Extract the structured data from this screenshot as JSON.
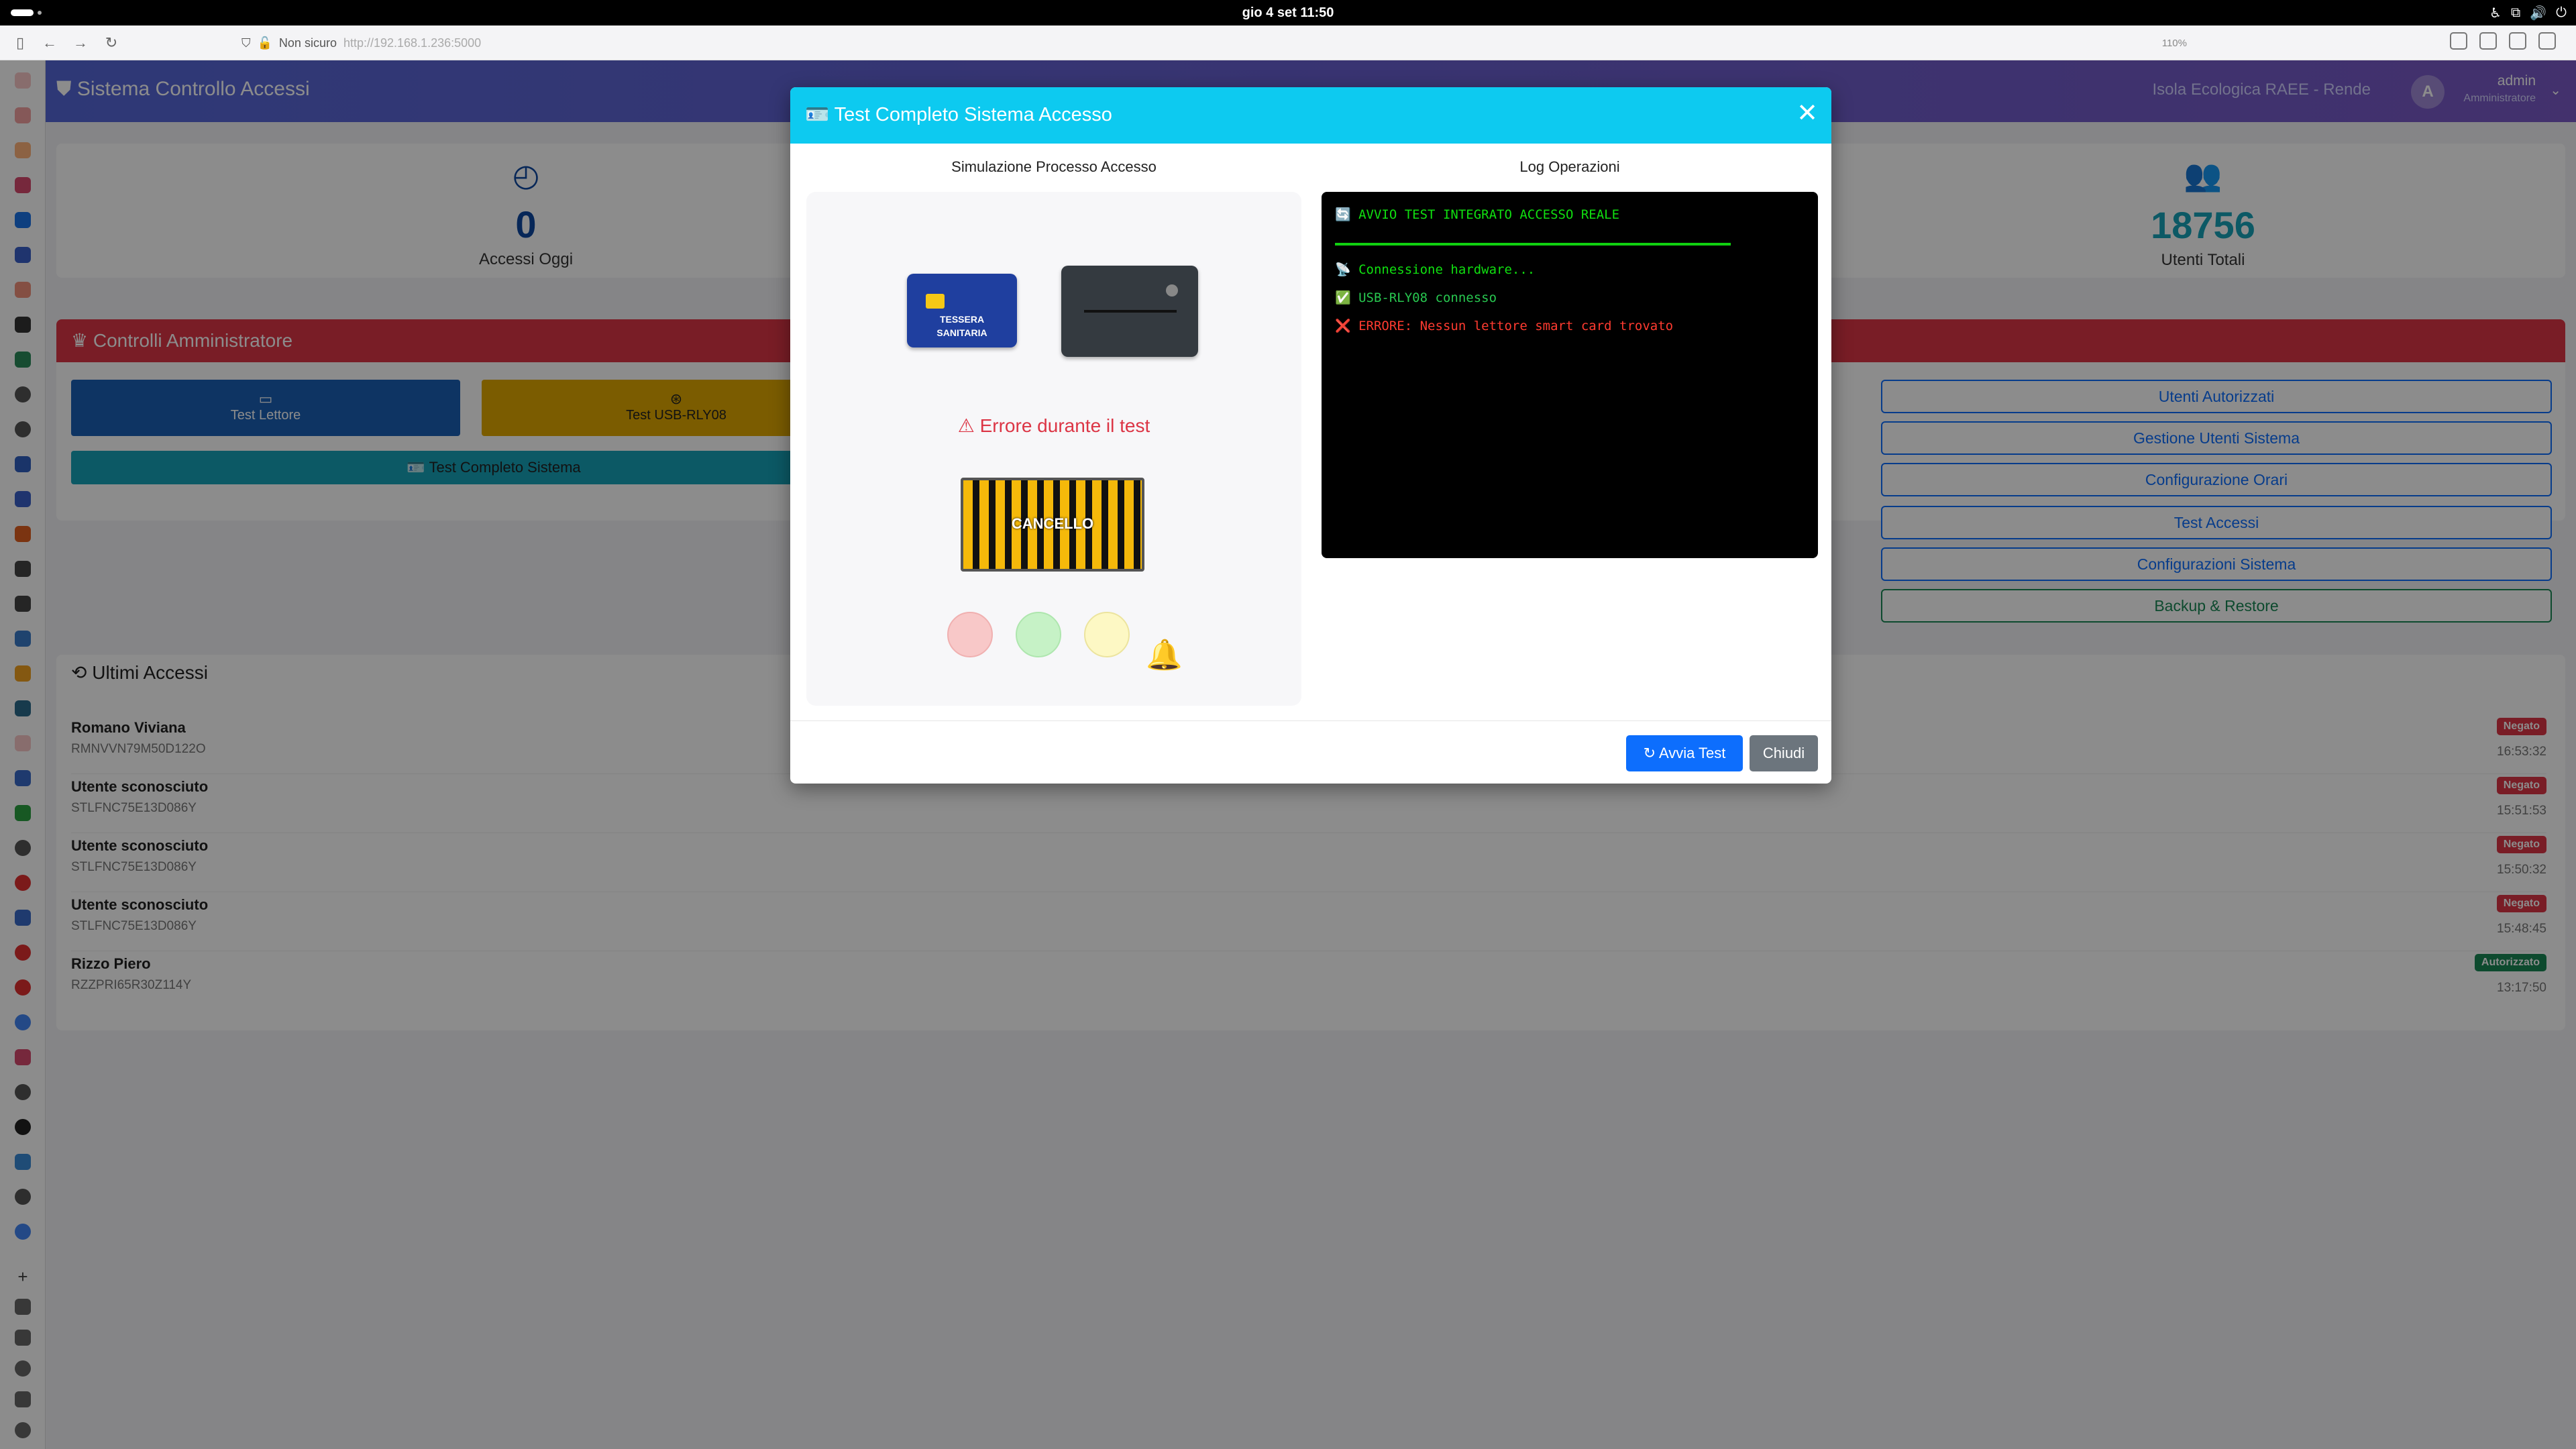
{
  "system": {
    "clock": "gio 4 set  11:50"
  },
  "browser": {
    "security_label": "Non sicuro",
    "url": "http://192.168.1.236:5000",
    "zoom": "110%"
  },
  "app": {
    "brand": "Sistema Controllo Accessi",
    "site": "Isola Ecologica RAEE - Rende",
    "user": {
      "initial": "A",
      "name": "admin",
      "role": "Amministratore"
    }
  },
  "stats": [
    {
      "value": "0",
      "label": "Accessi Oggi",
      "color": "#0d47a1"
    },
    {
      "value": "18756",
      "label": "Utenti Totali",
      "color": "#17a2b8"
    }
  ],
  "admin": {
    "title": "Controlli Amministratore",
    "buttons": {
      "test_reader": "Test Lettore",
      "test_relay": "Test USB-RLY08",
      "test_full": "Test Completo Sistema"
    },
    "links": [
      "Utenti Autorizzati",
      "Gestione Utenti Sistema",
      "Configurazione Orari",
      "Test Accessi",
      "Configurazioni Sistema",
      "Backup & Restore"
    ]
  },
  "recent": {
    "title": "Ultimi Accessi",
    "rows": [
      {
        "name": "Romano Viviana",
        "cf": "RMNVVN79M50D122O",
        "status": "Negato",
        "time": "16:53:32"
      },
      {
        "name": "Utente sconosciuto",
        "cf": "STLFNC75E13D086Y",
        "status": "Negato",
        "time": "15:51:53"
      },
      {
        "name": "Utente sconosciuto",
        "cf": "STLFNC75E13D086Y",
        "status": "Negato",
        "time": "15:50:32"
      },
      {
        "name": "Utente sconosciuto",
        "cf": "STLFNC75E13D086Y",
        "status": "Negato",
        "time": "15:48:45"
      },
      {
        "name": "Rizzo Piero",
        "cf": "RZZPRI65R30Z114Y",
        "status": "Autorizzato",
        "time": "13:17:50"
      }
    ]
  },
  "modal": {
    "title": "Test Completo Sistema Accesso",
    "left_title": "Simulazione Processo Accesso",
    "right_title": "Log Operazioni",
    "card_text_1": "TESSERA",
    "card_text_2": "SANITARIA",
    "error_text": "Errore durante il test",
    "gate_label": "CANCELLO",
    "log": {
      "line1": "AVVIO TEST INTEGRATO ACCESSO REALE",
      "line2": "Connessione hardware...",
      "line3": "USB-RLY08 connesso",
      "line4": "ERRORE: Nessun lettore smart card trovato"
    },
    "start_button": "Avvia Test",
    "close_button": "Chiudi"
  },
  "colors": {
    "accent": "#0dcaf0",
    "danger": "#dc3545",
    "primary": "#0d6efd",
    "success": "#198754",
    "warning": "#ffc107"
  }
}
